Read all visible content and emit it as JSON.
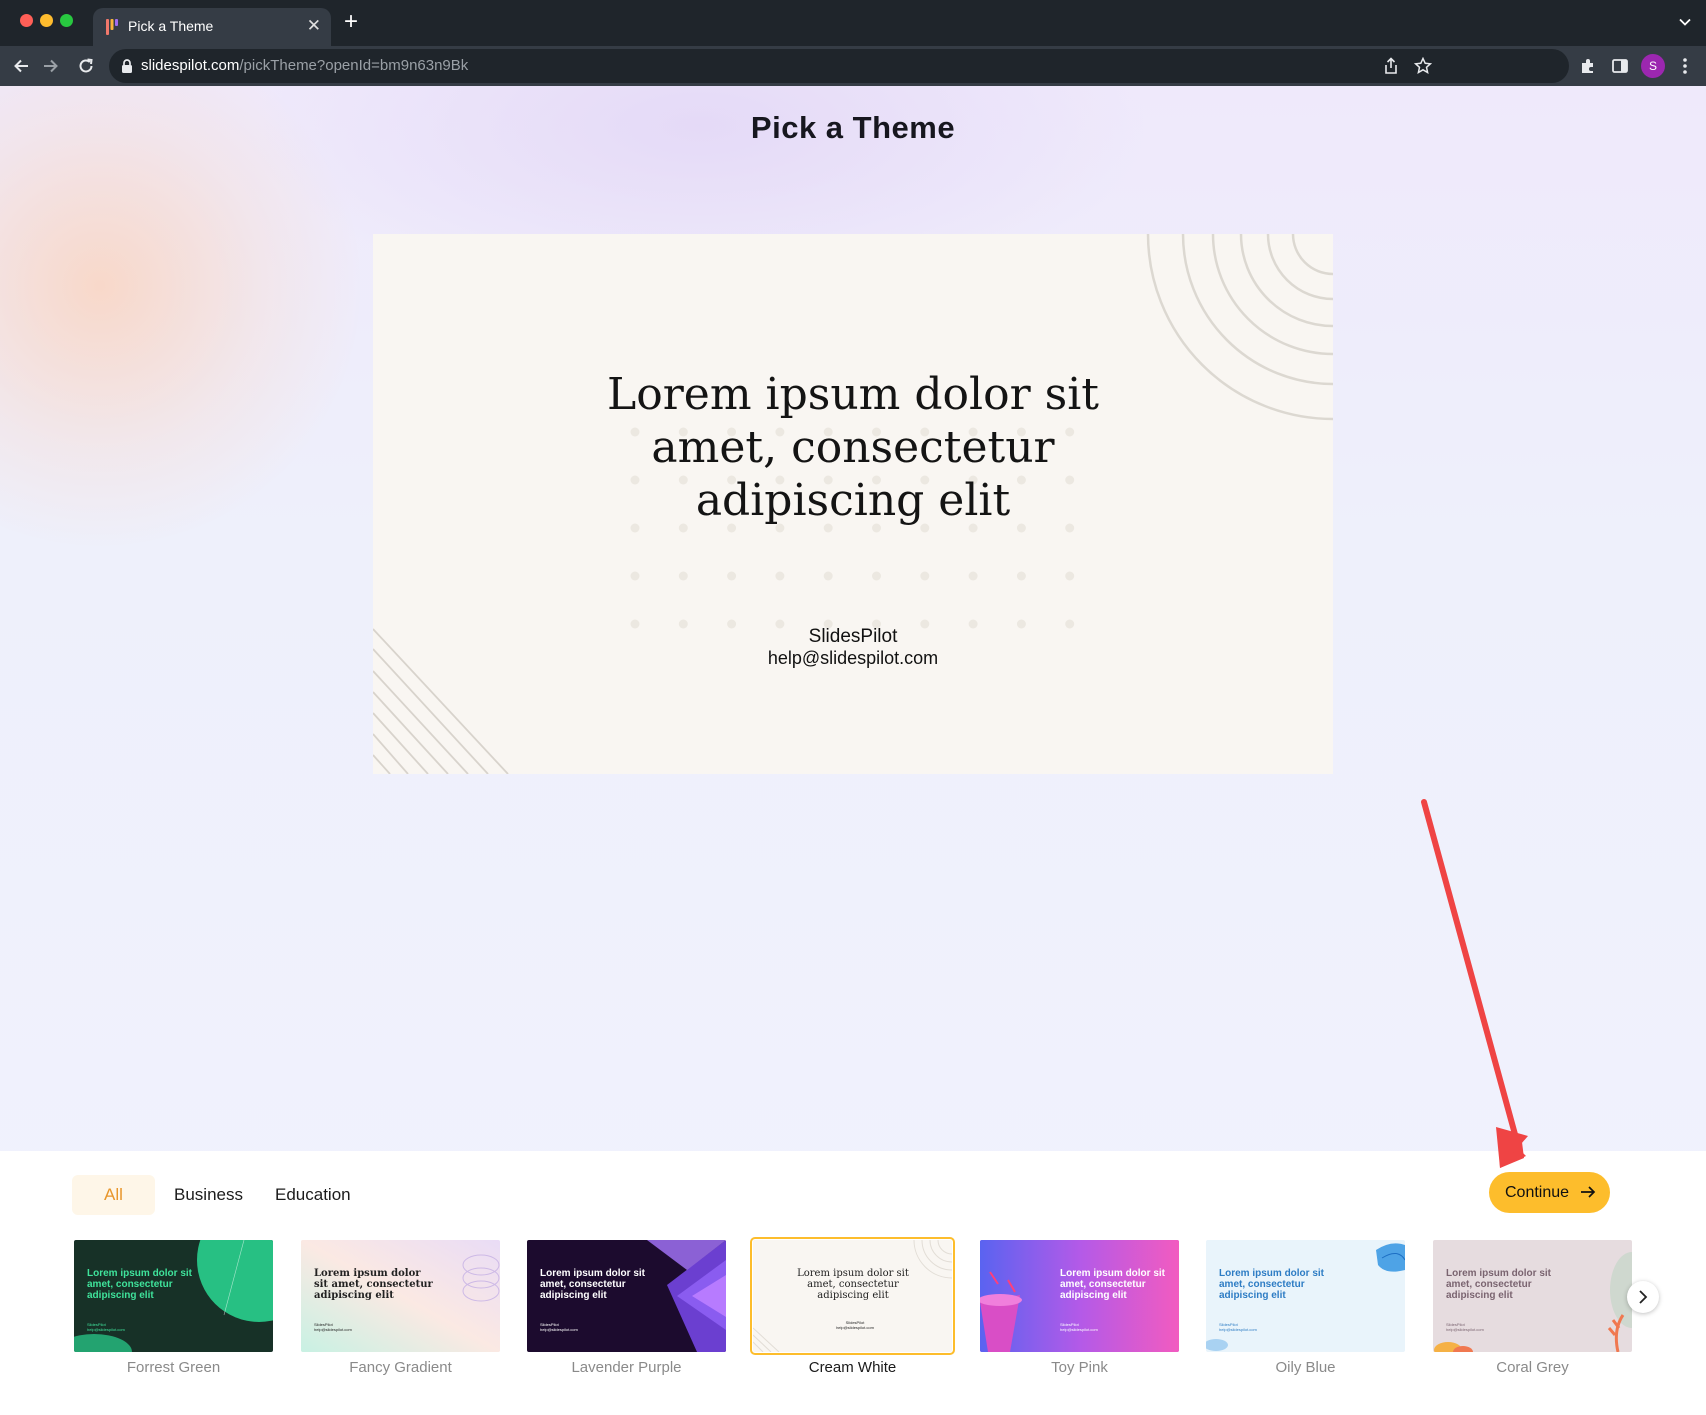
{
  "browser": {
    "tab_title": "Pick a Theme",
    "url_host": "slidespilot.com",
    "url_path": "/pickTheme?openId=bm9n63n9Bk",
    "profile_initial": "S"
  },
  "page": {
    "title": "Pick a Theme"
  },
  "preview": {
    "heading_line1": "Lorem ipsum dolor sit",
    "heading_line2": "amet, consectetur",
    "heading_line3": "adipiscing elit",
    "author": "SlidesPilot",
    "email": "help@slidespilot.com"
  },
  "filters": {
    "all": "All",
    "business": "Business",
    "education": "Education",
    "selected": "All"
  },
  "continue_label": "Continue",
  "themes": [
    {
      "name": "Forrest Green",
      "thumb_text": "Lorem ipsum dolor sit amet, consectetur adipiscing elit",
      "thumb_foot": "SlidesPilot help@slidespilot.com",
      "bg": "#173127",
      "accent": "#27c083",
      "text_color": "#3fe39b"
    },
    {
      "name": "Fancy Gradient",
      "thumb_text": "Lorem ipsum dolor sit amet, consectetur adipiscing elit",
      "thumb_foot": "SlidesPilot help@slidespilot.com",
      "bg": "#f4ecf3",
      "accent": "#cdb9e6",
      "text_color": "#222222"
    },
    {
      "name": "Lavender Purple",
      "thumb_text": "Lorem ipsum dolor sit amet, consectetur adipiscing elit",
      "thumb_foot": "SlidesPilot help@slidespilot.com",
      "bg": "#1c0b2e",
      "accent": "#8a5cf0",
      "text_color": "#ffffff"
    },
    {
      "name": "Cream White",
      "thumb_text": "Lorem ipsum dolor sit amet, consectetur adipiscing elit",
      "thumb_foot": "SlidesPilot help@slidespilot.com",
      "bg": "#f9f6f2",
      "accent": "#e2ddd6",
      "text_color": "#222222",
      "selected": true
    },
    {
      "name": "Toy Pink",
      "thumb_text": "Lorem ipsum dolor sit amet, consectetur adipiscing elit",
      "thumb_foot": "SlidesPilot help@slidespilot.com",
      "bg": "#c05be8",
      "accent": "#f25bc0",
      "text_color": "#ffffff"
    },
    {
      "name": "Oily Blue",
      "thumb_text": "Lorem ipsum dolor sit amet, consectetur adipiscing elit",
      "thumb_foot": "SlidesPilot help@slidespilot.com",
      "bg": "#e9f4fb",
      "accent": "#4ea3e6",
      "text_color": "#2d7cc4"
    },
    {
      "name": "Coral Grey",
      "thumb_text": "Lorem ipsum dolor sit amet, consectetur adipiscing elit",
      "thumb_foot": "SlidesPilot help@slidespilot.com",
      "bg": "#e6dcdf",
      "accent": "#f07850",
      "text_color": "#7a6470"
    }
  ],
  "colors": {
    "accent": "#fdbd2c",
    "annotation_arrow": "#ef4444",
    "selected_filter_text": "#e8962b"
  }
}
